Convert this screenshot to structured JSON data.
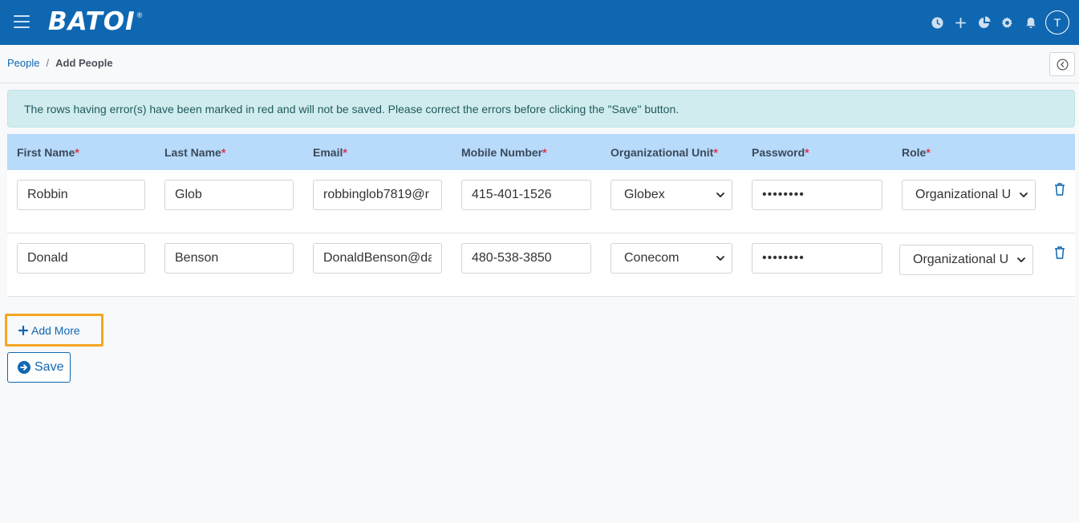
{
  "app": {
    "logo_text": "BATOI",
    "logo_reg": "®"
  },
  "header": {
    "icons": [
      "clock-icon",
      "plus-icon",
      "pie-chart-icon",
      "gear-icon",
      "bell-icon"
    ],
    "avatar_initial": "T"
  },
  "breadcrumb": {
    "parent": "People",
    "separator": "/",
    "current": "Add People"
  },
  "alert": {
    "message": "The rows having error(s) have been marked in red and will not be saved. Please correct the errors before clicking the \"Save\" button."
  },
  "table": {
    "columns": [
      {
        "label": "First Name",
        "required": "*"
      },
      {
        "label": "Last Name",
        "required": "*"
      },
      {
        "label": "Email",
        "required": "*"
      },
      {
        "label": "Mobile Number",
        "required": "*"
      },
      {
        "label": "Organizational Unit",
        "required": "*"
      },
      {
        "label": "Password",
        "required": "*"
      },
      {
        "label": "Role",
        "required": "*"
      }
    ],
    "rows": [
      {
        "first_name": "Robbin",
        "last_name": "Glob",
        "email": "robbinglob7819@r",
        "mobile": "415-401-1526",
        "org_unit": "Globex",
        "password": "••••••••",
        "role": "Organizational U"
      },
      {
        "first_name": "Donald",
        "last_name": "Benson",
        "email": "DonaldBenson@da",
        "mobile": "480-538-3850",
        "org_unit": "Conecom",
        "password": "••••••••",
        "role": "Organizational U"
      }
    ]
  },
  "actions": {
    "add_more_label": "Add More",
    "save_label": "Save"
  },
  "colors": {
    "primary": "#0f67b1",
    "header_row": "#b8dafb",
    "alert_bg": "#d1ecee",
    "highlight": "#f5a623",
    "required": "#dc3545"
  }
}
